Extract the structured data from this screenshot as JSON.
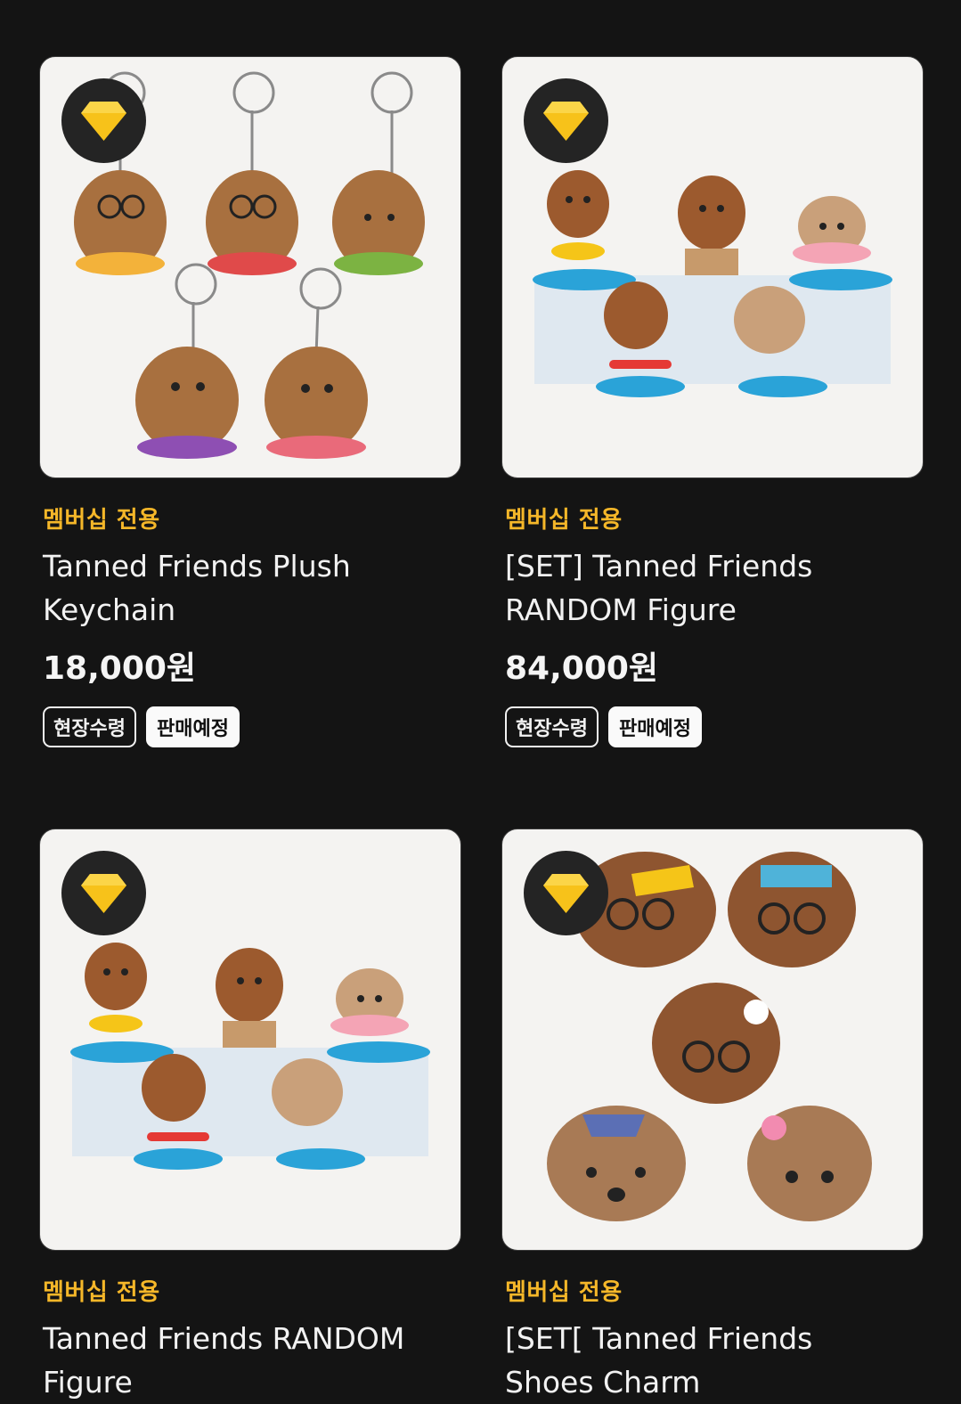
{
  "products": [
    {
      "badge_icon": "diamond-icon",
      "membership_label": "멤버십 전용",
      "name": "Tanned Friends Plush Keychain",
      "price": "18,000원",
      "tags": [
        "현장수령",
        "판매예정"
      ]
    },
    {
      "badge_icon": "diamond-icon",
      "membership_label": "멤버십 전용",
      "name": "[SET] Tanned Friends RANDOM Figure",
      "price": "84,000원",
      "tags": [
        "현장수령",
        "판매예정"
      ]
    },
    {
      "badge_icon": "diamond-icon",
      "membership_label": "멤버십 전용",
      "name": "Tanned Friends RANDOM Figure",
      "price": "",
      "tags": []
    },
    {
      "badge_icon": "diamond-icon",
      "membership_label": "멤버십 전용",
      "name": "[SET[ Tanned Friends Shoes Charm",
      "price": "",
      "tags": []
    }
  ],
  "colors": {
    "background": "#141414",
    "accent": "#f5b729",
    "badge": "#242424",
    "diamond": "#f7c21a"
  }
}
